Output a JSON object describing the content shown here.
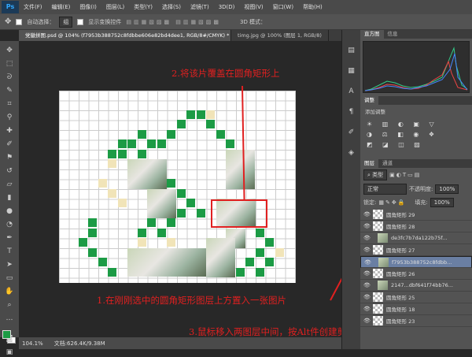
{
  "menu": [
    "文件(F)",
    "编辑(E)",
    "图像(I)",
    "图层(L)",
    "类型(Y)",
    "选择(S)",
    "滤镜(T)",
    "3D(D)",
    "视图(V)",
    "窗口(W)",
    "帮助(H)"
  ],
  "options": {
    "auto_select": "自动选择：",
    "auto_select_value": "组",
    "transform_controls": "显示变换控件",
    "mode3d": "3D 模式："
  },
  "tabs": [
    "党徽拼图.psd @ 104% (f7953b388752c8fdbbe606e82bd4dee1, RGB/8#/CMYK) *",
    "timg.jpg @ 100% (图层 1, RGB/8)"
  ],
  "status": {
    "zoom": "104.1%",
    "doc": "文档:626.4K/9.38M"
  },
  "annotations": {
    "note1": "1.在刚刚选中的圆角矩形图层上方置入一张图片",
    "note2": "2.将该片覆盖在圆角矩形上",
    "note3": "3.鼠标移入两图层中间，按Alt件创建剪贴蒙版"
  },
  "panels": {
    "histogram_tabs": [
      "直方图",
      "信息"
    ],
    "adjust_tabs": [
      "调整"
    ],
    "adjust_title": "添加调整",
    "layer_tabs": [
      "图层",
      "通道"
    ],
    "filter": "类型",
    "blend": "正常",
    "opacity_label": "不透明度:",
    "opacity": "100%",
    "lock_label": "锁定:",
    "fill_label": "填充:",
    "fill": "100%"
  },
  "layers": [
    {
      "name": "圆角矩形 29",
      "type": "shape",
      "selected": false
    },
    {
      "name": "圆角矩形 28",
      "type": "shape",
      "selected": false
    },
    {
      "name": "de3fc7b7da122b75f...",
      "type": "image",
      "selected": false
    },
    {
      "name": "圆角矩形 27",
      "type": "shape",
      "selected": false
    },
    {
      "name": "f7953b388752c8fdbb...",
      "type": "image",
      "selected": true
    },
    {
      "name": "圆角矩形 26",
      "type": "shape",
      "selected": false
    },
    {
      "name": "2147...dbf641f74bb76...",
      "type": "image",
      "selected": false
    },
    {
      "name": "圆角矩形 25",
      "type": "shape",
      "selected": false
    },
    {
      "name": "圆角矩形 18",
      "type": "shape",
      "selected": false
    },
    {
      "name": "圆角矩形 23",
      "type": "shape",
      "selected": false
    }
  ]
}
